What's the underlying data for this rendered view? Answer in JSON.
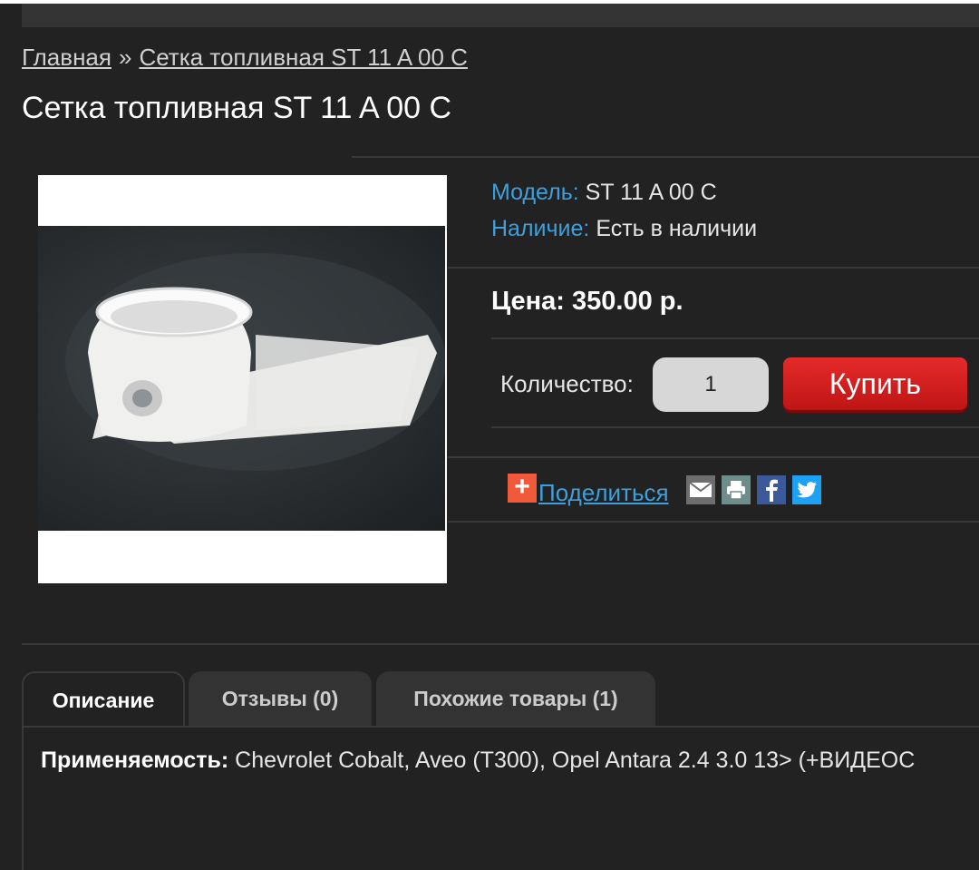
{
  "breadcrumb": {
    "home": "Главная",
    "separator": "»",
    "current": "Сетка топливная ST 11 A 00 C"
  },
  "product": {
    "title": "Сетка топливная ST 11 A 00 C",
    "model_label": "Модель:",
    "model_value": "ST 11 A 00 C",
    "availability_label": "Наличие:",
    "availability_value": "Есть в наличии",
    "price": "Цена: 350.00 р.",
    "quantity_label": "Количество:",
    "quantity_value": "1",
    "buy_label": "Купить"
  },
  "share": {
    "label": "Поделиться",
    "icons": [
      "plus-icon",
      "email-icon",
      "print-icon",
      "facebook-icon",
      "twitter-icon"
    ]
  },
  "tabs": [
    {
      "label": "Описание"
    },
    {
      "label": "Отзывы (0)"
    },
    {
      "label": "Похожие товары (1)"
    }
  ],
  "description": {
    "label": "Применяемость:",
    "text": " Chevrolet Cobalt, Aveo (T300), Opel Antara 2.4  3.0 13> (+ВИДЕОС"
  },
  "colors": {
    "background": "#222222",
    "accent_blue": "#3da0dd",
    "buy_red": "#d42020"
  }
}
